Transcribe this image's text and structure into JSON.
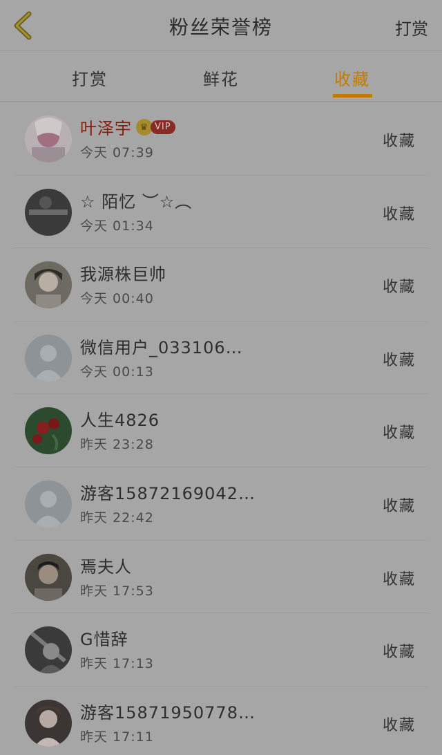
{
  "header": {
    "title": "粉丝荣誉榜",
    "action_label": "打赏"
  },
  "tabs": [
    {
      "label": "打赏",
      "active": false
    },
    {
      "label": "鲜花",
      "active": false
    },
    {
      "label": "收藏",
      "active": true
    }
  ],
  "accent_color": "#c47a00",
  "fans": [
    {
      "name": "叶泽宇",
      "time": "今天 07:39",
      "action": "收藏",
      "vip": "VIP",
      "highlight": true
    },
    {
      "name": "☆ 陌忆 ︶☆︵",
      "time": "今天 01:34",
      "action": "收藏"
    },
    {
      "name": "我源株巨帅",
      "time": "今天 00:40",
      "action": "收藏"
    },
    {
      "name": "微信用户_033106…",
      "time": "今天 00:13",
      "action": "收藏"
    },
    {
      "name": "人生4826",
      "time": "昨天 23:28",
      "action": "收藏"
    },
    {
      "name": "游客15872169042…",
      "time": "昨天 22:42",
      "action": "收藏"
    },
    {
      "name": "焉夫人",
      "time": "昨天 17:53",
      "action": "收藏"
    },
    {
      "name": "G惜辞",
      "time": "昨天 17:13",
      "action": "收藏"
    },
    {
      "name": "游客15871950778…",
      "time": "昨天 17:11",
      "action": "收藏"
    }
  ]
}
